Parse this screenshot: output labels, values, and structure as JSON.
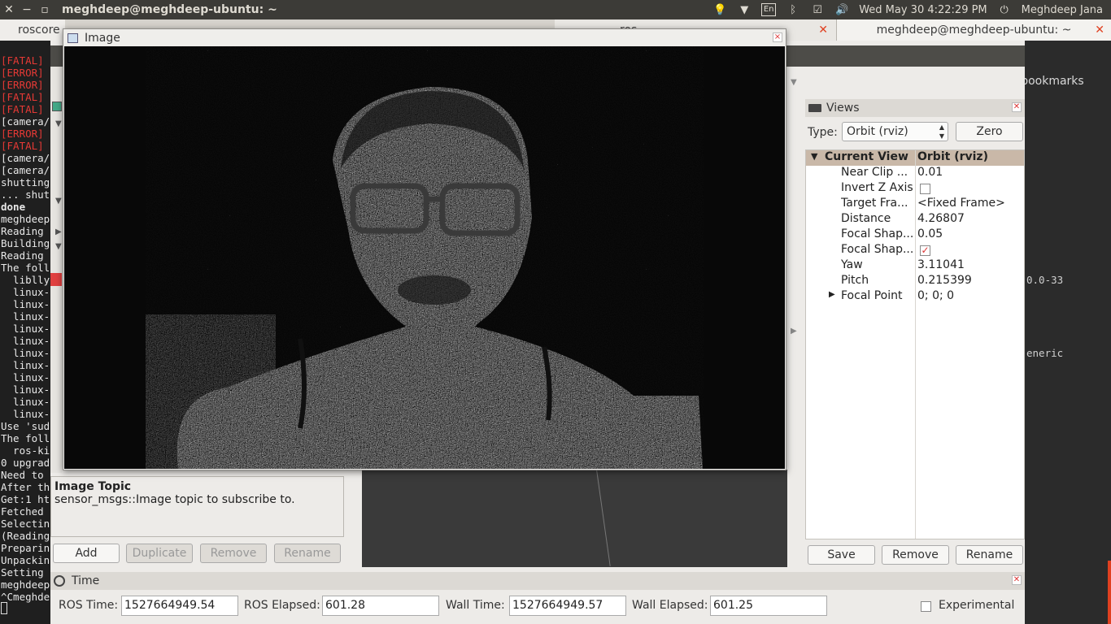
{
  "topbar": {
    "window_title": "meghdeep@meghdeep-ubuntu: ~",
    "language": "En",
    "datetime": "Wed May 30  4:22:29 PM",
    "user": "Meghdeep Jana"
  },
  "terminal_tabs": [
    {
      "label": "roscore"
    },
    {
      "label": "ros"
    },
    {
      "label": "meghdeep@meghdeep-ubuntu: ~"
    }
  ],
  "terminal_lines": [
    {
      "text": "[FATAL]",
      "style": "red"
    },
    {
      "text": "[ERROR]",
      "style": "red"
    },
    {
      "text": "[ERROR]",
      "style": "red"
    },
    {
      "text": "[FATAL]",
      "style": "red"
    },
    {
      "text": "[FATAL]",
      "style": "red"
    },
    {
      "text": "[camera/",
      "style": ""
    },
    {
      "text": "[ERROR]",
      "style": "red"
    },
    {
      "text": "[FATAL]",
      "style": "red"
    },
    {
      "text": "[camera/",
      "style": ""
    },
    {
      "text": "[camera/",
      "style": ""
    },
    {
      "text": "shutting",
      "style": ""
    },
    {
      "text": "... shut",
      "style": ""
    },
    {
      "text": "done",
      "style": "bold"
    },
    {
      "text": "meghdeep",
      "style": ""
    },
    {
      "text": "Reading",
      "style": ""
    },
    {
      "text": "Building",
      "style": ""
    },
    {
      "text": "Reading",
      "style": ""
    },
    {
      "text": "The foll",
      "style": ""
    },
    {
      "text": "  liblly",
      "style": ""
    },
    {
      "text": "  linux-",
      "style": ""
    },
    {
      "text": "  linux-",
      "style": ""
    },
    {
      "text": "  linux-",
      "style": ""
    },
    {
      "text": "  linux-",
      "style": ""
    },
    {
      "text": "  linux-",
      "style": ""
    },
    {
      "text": "  linux-",
      "style": ""
    },
    {
      "text": "  linux-",
      "style": ""
    },
    {
      "text": "  linux-",
      "style": ""
    },
    {
      "text": "  linux-",
      "style": ""
    },
    {
      "text": "  linux-",
      "style": ""
    },
    {
      "text": "  linux-",
      "style": ""
    },
    {
      "text": "Use 'sud",
      "style": ""
    },
    {
      "text": "The foll",
      "style": ""
    },
    {
      "text": "  ros-ki",
      "style": ""
    },
    {
      "text": "0 upgrad",
      "style": ""
    },
    {
      "text": "Need to",
      "style": ""
    },
    {
      "text": "After th",
      "style": ""
    },
    {
      "text": "Get:1 ht",
      "style": ""
    },
    {
      "text": "Fetched",
      "style": ""
    },
    {
      "text": "Selectin",
      "style": ""
    },
    {
      "text": "(Reading",
      "style": ""
    },
    {
      "text": "Preparin",
      "style": ""
    },
    {
      "text": "Unpackin",
      "style": ""
    },
    {
      "text": "Setting",
      "style": ""
    },
    {
      "text": "meghdeep",
      "style": ""
    },
    {
      "text": "^Cmeghde",
      "style": ""
    }
  ],
  "right_terminal": {
    "bookmarks": "r bookmarks",
    "kernel": "0.0-33",
    "generic": "eneric"
  },
  "image_window": {
    "title": "Image",
    "close": "×"
  },
  "views_panel": {
    "title": "Views",
    "type_label": "Type:",
    "type_value": "Orbit (rviz)",
    "zero_button": "Zero",
    "header_key": "Current View",
    "header_value": "Orbit (rviz)",
    "rows": [
      {
        "key": "Near Clip ...",
        "value": "0.01"
      },
      {
        "key": "Invert Z Axis",
        "value": ""
      },
      {
        "key": "Target Fra...",
        "value": "<Fixed Frame>"
      },
      {
        "key": "Distance",
        "value": "4.26807"
      },
      {
        "key": "Focal Shap...",
        "value": "0.05"
      },
      {
        "key": "Focal Shap...",
        "value": ""
      },
      {
        "key": "Yaw",
        "value": "3.11041"
      },
      {
        "key": "Pitch",
        "value": "0.215399"
      },
      {
        "key": "Focal Point",
        "value": "0; 0; 0"
      }
    ],
    "invert_z_checked": false,
    "focal_shape_checked": true,
    "save_button": "Save",
    "remove_button": "Remove",
    "rename_button": "Rename"
  },
  "displays_panel": {
    "desc_title": "Image Topic",
    "desc_text": "sensor_msgs::Image topic to subscribe to.",
    "add_button": "Add",
    "duplicate_button": "Duplicate",
    "remove_button": "Remove",
    "rename_button": "Rename"
  },
  "time_panel": {
    "title": "Time",
    "ros_time_label": "ROS Time:",
    "ros_time": "1527664949.54",
    "ros_elapsed_label": "ROS Elapsed:",
    "ros_elapsed": "601.28",
    "wall_time_label": "Wall Time:",
    "wall_time": "1527664949.57",
    "wall_elapsed_label": "Wall Elapsed:",
    "wall_elapsed": "601.25",
    "experimental_label": "Experimental",
    "experimental_checked": false
  },
  "colors": {
    "error_red": "#e53935",
    "topbar": "#3c3b37",
    "tree_header": "#c9b8a8"
  }
}
